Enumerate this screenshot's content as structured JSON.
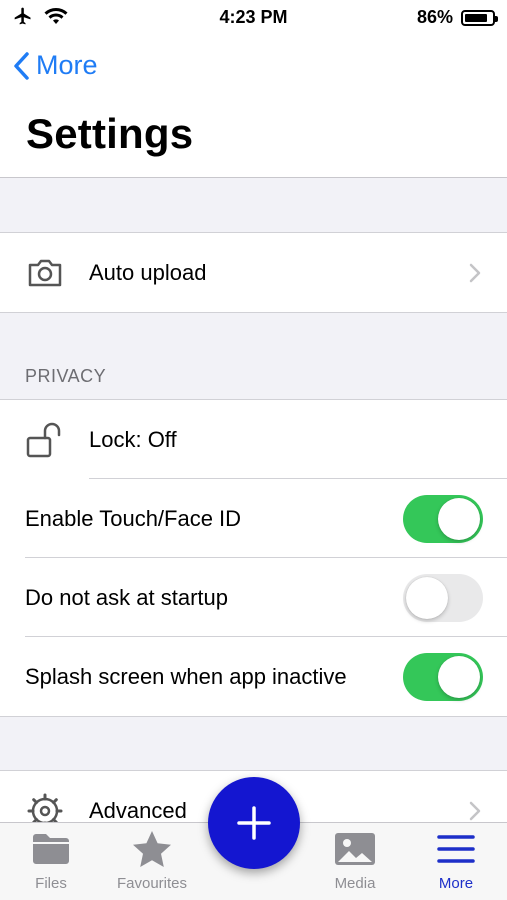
{
  "status_bar": {
    "time": "4:23 PM",
    "battery": "86%",
    "battery_level": 0.86
  },
  "nav": {
    "back_label": "More",
    "title": "Settings"
  },
  "auto_upload": {
    "label": "Auto upload",
    "icon": "camera-icon"
  },
  "privacy": {
    "header": "PRIVACY",
    "lock_label": "Lock: Off",
    "rows": [
      {
        "label": "Enable Touch/Face ID",
        "on": true
      },
      {
        "label": "Do not ask at startup",
        "on": false
      },
      {
        "label": "Splash screen when app inactive",
        "on": true
      }
    ]
  },
  "advanced": {
    "label": "Advanced",
    "icon": "gear-icon"
  },
  "tabs": [
    {
      "label": "Files",
      "icon": "folder-icon",
      "active": false
    },
    {
      "label": "Favourites",
      "icon": "star-icon",
      "active": false
    },
    {
      "label": "Media",
      "icon": "photo-icon",
      "active": false
    },
    {
      "label": "More",
      "icon": "menu-icon",
      "active": true
    }
  ],
  "colors": {
    "accent": "#1f7cf5",
    "toggle_on": "#34c759",
    "fab": "#1416d0",
    "tab_active": "#1d2fc9"
  }
}
